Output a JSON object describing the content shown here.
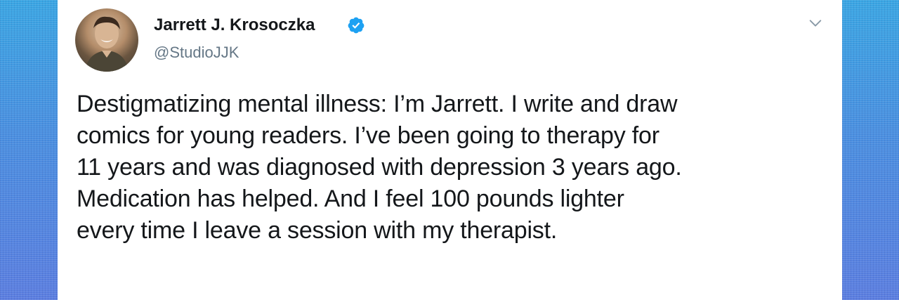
{
  "tweet": {
    "author_name": "Jarrett J. Krosoczka",
    "handle": "@StudioJJK",
    "verified": true,
    "text": "Destigmatizing mental illness: I’m Jarrett. I write and draw\ncomics for young readers. I’ve been going to therapy for\n11 years and was diagnosed with depression 3 years ago.\nMedication has helped. And I feel 100 pounds lighter\nevery time I leave a session with my therapist."
  },
  "icons": {
    "verified": "verified-badge-icon",
    "menu": "chevron-down-icon"
  },
  "colors": {
    "verified_blue": "#1da1f2",
    "text": "#14171a",
    "secondary_text": "#657786",
    "background_gradient_top": "#3aa6e3",
    "background_gradient_bottom": "#5b7ee0"
  }
}
